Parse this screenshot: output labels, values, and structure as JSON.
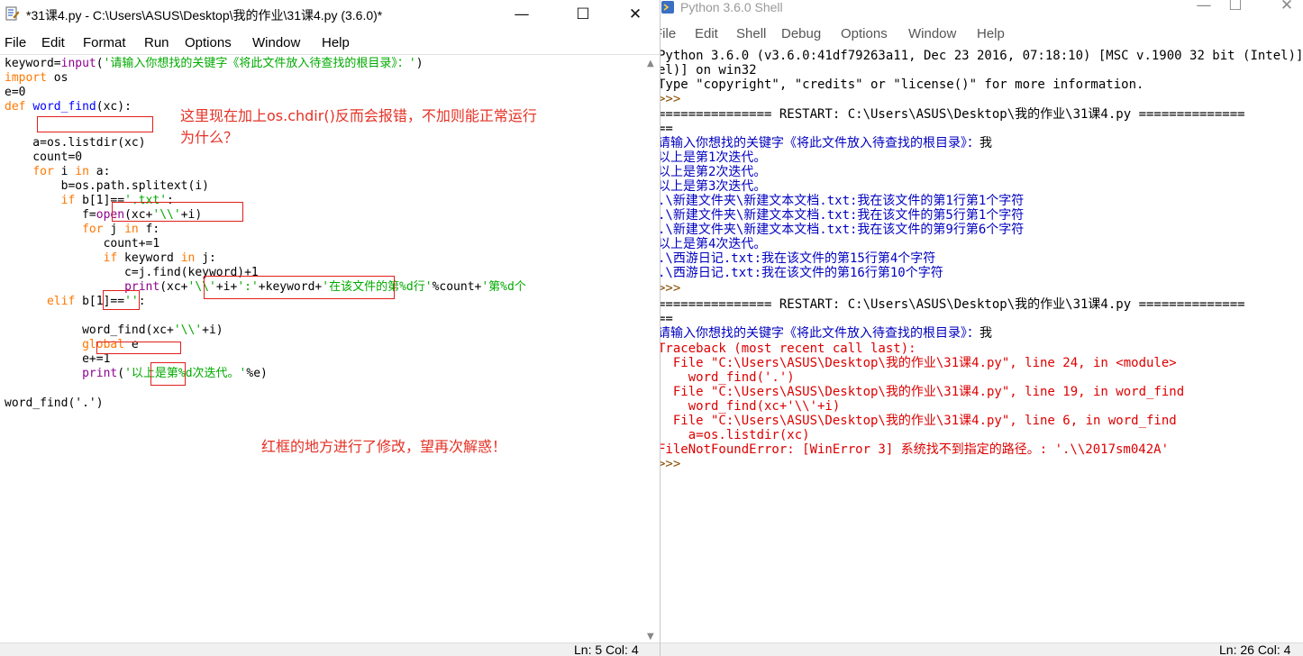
{
  "editor": {
    "title": "*31课4.py - C:\\Users\\ASUS\\Desktop\\我的作业\\31课4.py (3.6.0)*",
    "controls": {
      "minimize": "—",
      "maximize": "☐",
      "close": "✕"
    },
    "menu": [
      "File",
      "Edit",
      "Format",
      "Run",
      "Options",
      "Window",
      "Help"
    ],
    "code": {
      "l1": {
        "a": "keyword=",
        "b": "input",
        "c": "(",
        "d": "'请输入你想找的关键字《将此文件放入待查找的根目录》：'",
        "e": ")"
      },
      "l2": {
        "a": "import",
        "b": " os"
      },
      "l3": "e=0",
      "l4": {
        "a": "def",
        "b": " ",
        "c": "word_find",
        "d": "(xc):"
      },
      "l6": "    a=os.listdir(xc)",
      "l7": "    count=0",
      "l8": {
        "a": "    ",
        "b": "for",
        "c": " i ",
        "d": "in",
        "e": " a:"
      },
      "l9": "        b=os.path.splitext(i)",
      "l10": {
        "a": "        ",
        "b": "if",
        "c": " b[1]==",
        "d": "'.txt'",
        "e": ":"
      },
      "l11": {
        "a": "           f=",
        "b": "open",
        "c": "(xc+",
        "d": "'\\\\'",
        "e": "+i)"
      },
      "l12": {
        "a": "           ",
        "b": "for",
        "c": " j ",
        "d": "in",
        "e": " f:"
      },
      "l13": "              count+=1",
      "l14": {
        "a": "              ",
        "b": "if",
        "c": " keyword ",
        "d": "in",
        "e": " j:"
      },
      "l15": "                 c=j.find(keyword)+1",
      "l16": {
        "a": "                 ",
        "b": "print",
        "c": "(xc+",
        "d": "'\\\\'",
        "e": "+i+",
        "f": "':'",
        "g": "+keyword+",
        "h": "'在该文件的第%d行'",
        "i": "%count+",
        "j": "'第%d个"
      },
      "l17": {
        "a": "      ",
        "b": "elif",
        "c": " b[1]==",
        "d": "''",
        "e": ":"
      },
      "l19": {
        "a": "           word_find(xc+",
        "b": "'\\\\'",
        "c": "+i)"
      },
      "l20": {
        "a": "           ",
        "b": "global",
        "c": " e"
      },
      "l21": "           e+=1",
      "l22": {
        "a": "           ",
        "b": "print",
        "c": "(",
        "d": "'以上是第%d次迭代。'",
        "e": "%e)"
      },
      "l24": "word_find('.')"
    },
    "annotation_1_line1": "这里现在加上os.chdir()反而会报错，不加则能正常运行",
    "annotation_1_line2": "为什么？",
    "annotation_2": "红框的地方进行了修改，望再次解惑！",
    "status": "Ln: 5   Col: 4"
  },
  "shell": {
    "title": "Python 3.6.0 Shell",
    "controls": {
      "minimize": "—",
      "maximize": "☐",
      "close": "✕"
    },
    "menu": [
      "File",
      "Edit",
      "Shell",
      "Debug",
      "Options",
      "Window",
      "Help"
    ],
    "lines": [
      "Python 3.6.0 (v3.6.0:41df79263a11, Dec 23 2016, 07:18:10) [MSC v.1900 32 bit (Intel)] on win32",
      "el)] on win32",
      "Type \"copyright\", \"credits\" or \"license()\" for more information.",
      ">>>",
      "=============== RESTART: C:\\Users\\ASUS\\Desktop\\我的作业\\31课4.py ==============",
      "==",
      "请输入你想找的关键字《将此文件放入待查找的根目录》：",
      "我",
      "以上是第1次迭代。",
      "以上是第2次迭代。",
      "以上是第3次迭代。",
      ".\\新建文件夹\\新建文本文档.txt:我在该文件的第1行第1个字符",
      ".\\新建文件夹\\新建文本文档.txt:我在该文件的第5行第1个字符",
      ".\\新建文件夹\\新建文本文档.txt:我在该文件的第9行第6个字符",
      "以上是第4次迭代。",
      ".\\西游日记.txt:我在该文件的第15行第4个字符",
      ".\\西游日记.txt:我在该文件的第16行第10个字符",
      ">>>",
      "=============== RESTART: C:\\Users\\ASUS\\Desktop\\我的作业\\31课4.py ==============",
      "==",
      "请输入你想找的关键字《将此文件放入待查找的根目录》：",
      "我",
      "Traceback (most recent call last):",
      "  File \"C:\\Users\\ASUS\\Desktop\\我的作业\\31课4.py\", line 24, in <module>",
      "    word_find('.')",
      "  File \"C:\\Users\\ASUS\\Desktop\\我的作业\\31课4.py\", line 19, in word_find",
      "    word_find(xc+'\\\\'+i)",
      "  File \"C:\\Users\\ASUS\\Desktop\\我的作业\\31课4.py\", line 6, in word_find",
      "    a=os.listdir(xc)",
      "FileNotFoundError: [WinError 3] 系统找不到指定的路径。: '.\\\\2017sm042A'",
      ">>>"
    ],
    "status": "Ln: 26   Col: 4"
  }
}
